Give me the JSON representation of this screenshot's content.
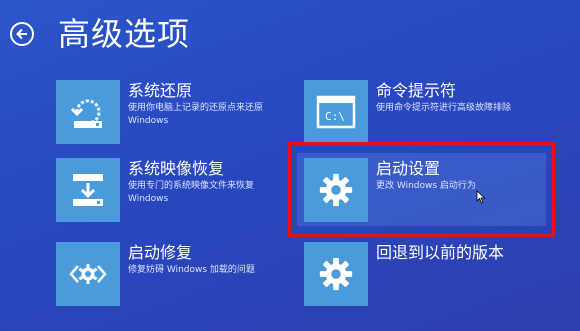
{
  "header": {
    "title": "高级选项"
  },
  "options": [
    {
      "id": "system-restore",
      "title": "系统还原",
      "desc1": "使用你电脑上记录的还原点来还原",
      "desc2": "Windows",
      "icon": "restore-icon"
    },
    {
      "id": "command-prompt",
      "title": "命令提示符",
      "desc1": "使用命令提示符进行高级故障排除",
      "desc2": "",
      "icon": "command-prompt-icon"
    },
    {
      "id": "system-image-recovery",
      "title": "系统映像恢复",
      "desc1": "使用专门的系统映像文件来恢复",
      "desc2": "Windows",
      "icon": "image-recovery-icon"
    },
    {
      "id": "startup-settings",
      "title": "启动设置",
      "desc1": "更改 Windows 启动行为",
      "desc2": "",
      "icon": "gear-icon"
    },
    {
      "id": "startup-repair",
      "title": "启动修复",
      "desc1": "修复妨碍 Windows 加载的问题",
      "desc2": "",
      "icon": "repair-icon"
    },
    {
      "id": "go-back",
      "title": "回退到以前的版本",
      "desc1": "",
      "desc2": "",
      "icon": "gear-icon"
    }
  ],
  "colors": {
    "background": "#2a4fc4",
    "tile": "#4a9bdb",
    "highlight_border": "#e4101a"
  }
}
